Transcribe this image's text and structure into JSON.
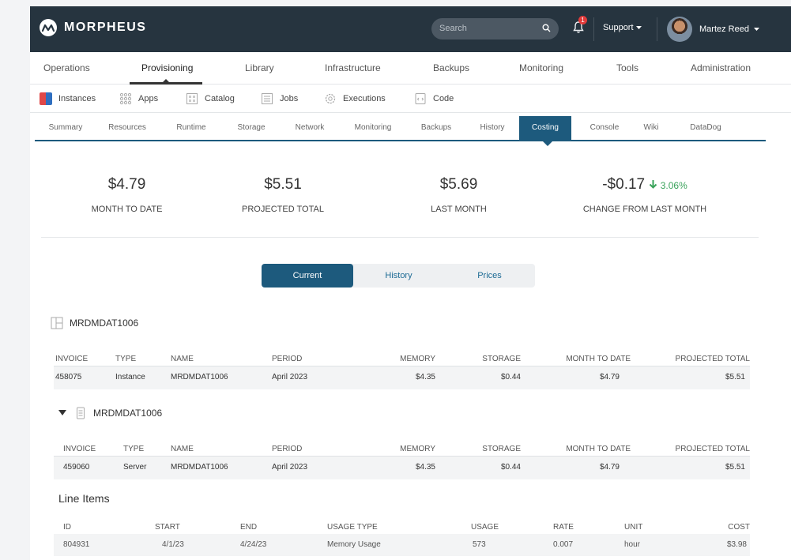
{
  "brand": {
    "name": "MORPHEUS"
  },
  "header": {
    "search_placeholder": "Search",
    "notification_count": "1",
    "support_label": "Support",
    "user_name": "Martez Reed"
  },
  "main_nav": [
    "Operations",
    "Provisioning",
    "Library",
    "Infrastructure",
    "Backups",
    "Monitoring",
    "Tools",
    "Administration"
  ],
  "sub_nav": [
    "Instances",
    "Apps",
    "Catalog",
    "Jobs",
    "Executions",
    "Code"
  ],
  "instance_tabs": [
    "Summary",
    "Resources",
    "Runtime",
    "Storage",
    "Network",
    "Monitoring",
    "Backups",
    "History",
    "Costing",
    "Console",
    "Wiki",
    "DataDog"
  ],
  "summary": {
    "month_to_date": {
      "value": "$4.79",
      "label": "MONTH TO DATE"
    },
    "projected_total": {
      "value": "$5.51",
      "label": "PROJECTED TOTAL"
    },
    "last_month": {
      "value": "$5.69",
      "label": "LAST MONTH"
    },
    "change": {
      "value": "-$0.17",
      "percent": "3.06%",
      "label": "CHANGE FROM LAST MONTH"
    }
  },
  "segments": [
    "Current",
    "History",
    "Prices"
  ],
  "columns": [
    "INVOICE",
    "TYPE",
    "NAME",
    "PERIOD",
    "MEMORY",
    "STORAGE",
    "MONTH TO DATE",
    "PROJECTED TOTAL"
  ],
  "instance_section": {
    "title": "MRDMDAT1006",
    "row": {
      "invoice": "458075",
      "type": "Instance",
      "name": "MRDMDAT1006",
      "period": "April 2023",
      "memory": "$4.35",
      "storage": "$0.44",
      "mtd": "$4.79",
      "projected": "$5.51"
    }
  },
  "server_section": {
    "title": "MRDMDAT1006",
    "row": {
      "invoice": "459060",
      "type": "Server",
      "name": "MRDMDAT1006",
      "period": "April 2023",
      "memory": "$4.35",
      "storage": "$0.44",
      "mtd": "$4.79",
      "projected": "$5.51"
    }
  },
  "line_items": {
    "title": "Line Items",
    "columns": [
      "ID",
      "START",
      "END",
      "USAGE TYPE",
      "USAGE",
      "RATE",
      "UNIT",
      "COST"
    ],
    "rows": [
      {
        "id": "804931",
        "start": "4/1/23",
        "end": "4/24/23",
        "usage_type": "Memory Usage",
        "usage": "573",
        "rate": "0.007",
        "unit": "hour",
        "cost": "$3.98"
      }
    ]
  },
  "colors": {
    "topbar": "#26343f",
    "accent": "#1d5a7d",
    "link": "#2b7bb0",
    "positive": "#3aa35b"
  }
}
